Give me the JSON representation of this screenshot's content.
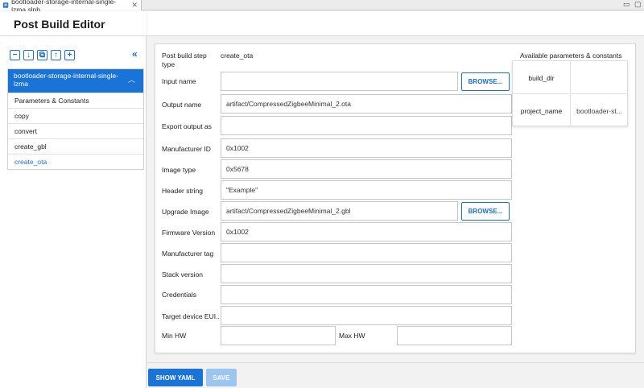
{
  "tab": {
    "title": "bootloader-storage-internal-single-lzma.slpb",
    "close": "✕"
  },
  "window": {
    "minimize": "▭",
    "maximize": "▢"
  },
  "page": {
    "title": "Post Build Editor"
  },
  "toolbar": {
    "remove": "−",
    "download": "↓",
    "copy": "⧉",
    "up": "↑",
    "add": "+",
    "collapse": "«"
  },
  "tree": {
    "root": "bootloader-storage-internal-single-lzma",
    "items": [
      "Parameters & Constants",
      "copy",
      "convert",
      "create_gbl",
      "create_ota"
    ]
  },
  "form": {
    "step_type_label": "Post build step type",
    "step_type_value": "create_ota",
    "input_name_label": "Input name",
    "input_name_value": "",
    "browse_label": "BROWSE...",
    "output_name_label": "Output name",
    "output_name_value": "artifact/CompressedZigbeeMinimal_2.ota",
    "export_output_label": "Export output as",
    "export_output_value": "",
    "manufacturer_id_label": "Manufacturer ID",
    "manufacturer_id_value": "0x1002",
    "image_type_label": "Image type",
    "image_type_value": "0x5678",
    "header_string_label": "Header string",
    "header_string_value": "\"Example\"",
    "upgrade_image_label": "Upgrade Image",
    "upgrade_image_value": "artifact/CompressedZigbeeMinimal_2.gbl",
    "firmware_version_label": "Firmware Version",
    "firmware_version_value": "0x1002",
    "manufacturer_tag_label": "Manufacturer tag",
    "manufacturer_tag_value": "",
    "stack_version_label": "Stack version",
    "stack_version_value": "",
    "credentials_label": "Credentials",
    "credentials_value": "",
    "target_eui_label": "Target device EUI...",
    "target_eui_value": "",
    "min_hw_label": "Min HW",
    "min_hw_value": "",
    "max_hw_label": "Max HW",
    "max_hw_value": ""
  },
  "params": {
    "title": "Available parameters & constants",
    "rows": [
      {
        "key": "build_dir",
        "value": ""
      },
      {
        "key": "project_name",
        "value": "bootloader-st..."
      }
    ]
  },
  "actions": {
    "show_yaml": "SHOW YAML",
    "save": "SAVE"
  },
  "colors": {
    "accent": "#1a73d6",
    "disabled": "#9cc5ef"
  }
}
